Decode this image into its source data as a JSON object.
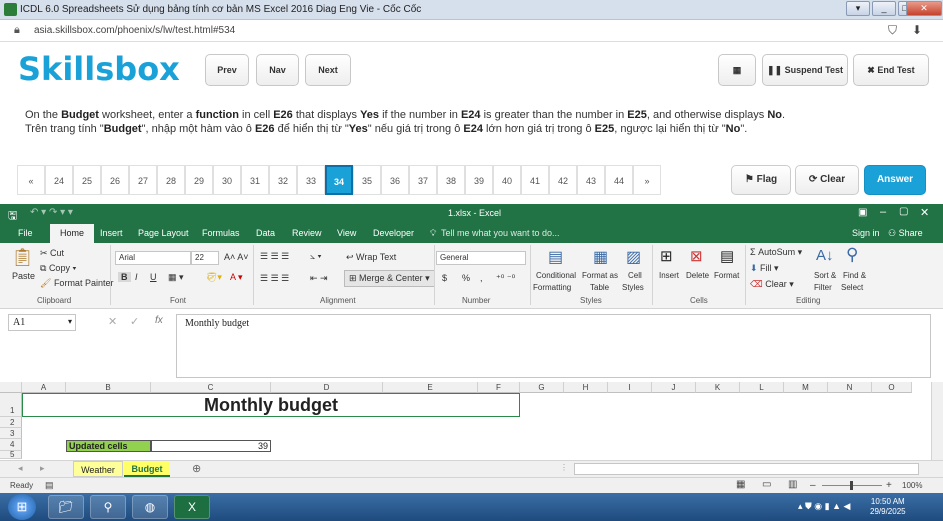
{
  "browser": {
    "title": "ICDL 6.0 Spreadsheets Sử dụng bảng tính cơ bản MS Excel 2016 Diag Eng Vie - Cốc Cốc",
    "url": "asia.skillsbox.com/phoenix/s/lw/test.html#534"
  },
  "skillsbox": {
    "logo": "Skillsbox",
    "prev": "Prev",
    "nav": "Nav",
    "next": "Next",
    "suspend": "Suspend Test",
    "end": "End Test"
  },
  "instruction": {
    "en": [
      "On the ",
      "Budget",
      " worksheet, enter a ",
      "function",
      " in cell ",
      "E26",
      " that displays ",
      "Yes",
      " if the number in ",
      "E24",
      " is greater than the number in ",
      "E25",
      ", and otherwise displays ",
      "No",
      "."
    ],
    "vi": [
      "Trên trang tính \"",
      "Budget",
      "\", nhập một hàm vào ô ",
      "E26",
      " để hiển thị từ \"",
      "Yes",
      "\" nếu giá trị trong ô ",
      "E24",
      " lớn hơn giá trị trong ô ",
      "E25",
      ", ngược lại hiển thị từ \"",
      "No",
      "\"."
    ]
  },
  "questions": {
    "first": "«",
    "last": "»",
    "numbers": [
      "24",
      "25",
      "26",
      "27",
      "28",
      "29",
      "30",
      "31",
      "32",
      "33",
      "34",
      "35",
      "36",
      "37",
      "38",
      "39",
      "40",
      "41",
      "42",
      "43",
      "44"
    ],
    "active": "34",
    "flag": "Flag",
    "clear": "Clear",
    "answer": "Answer"
  },
  "excel": {
    "filename": "1.xlsx - Excel",
    "tabs": [
      "File",
      "Home",
      "Insert",
      "Page Layout",
      "Formulas",
      "Data",
      "Review",
      "View",
      "Developer"
    ],
    "tellme": "Tell me what you want to do...",
    "signin": "Sign in",
    "share": "Share",
    "clipboard": {
      "paste": "Paste",
      "cut": "Cut",
      "copy": "Copy",
      "format_painter": "Format Painter",
      "label": "Clipboard"
    },
    "font": {
      "name": "Arial",
      "size": "22",
      "label": "Font",
      "b": "B",
      "i": "I",
      "u": "U"
    },
    "alignment": {
      "wrap": "Wrap Text",
      "merge": "Merge & Center",
      "label": "Alignment"
    },
    "number": {
      "format": "General",
      "label": "Number",
      "currency": "$",
      "percent": "%",
      "comma": ","
    },
    "styles": {
      "conditional": "Conditional",
      "formatting": "Formatting",
      "format_as": "Format as",
      "table": "Table",
      "cell": "Cell",
      "styles": "Styles",
      "label": "Styles"
    },
    "cells": {
      "insert": "Insert",
      "delete": "Delete",
      "format": "Format",
      "label": "Cells"
    },
    "editing": {
      "autosum": "AutoSum",
      "fill": "Fill",
      "clear": "Clear",
      "sort": "Sort &",
      "filter": "Filter",
      "find": "Find &",
      "select": "Select",
      "label": "Editing"
    },
    "namebox": "A1",
    "formula": "Monthly budget",
    "columns": [
      "A",
      "B",
      "C",
      "D",
      "E",
      "F",
      "G",
      "H",
      "I",
      "J",
      "K",
      "L",
      "M",
      "N",
      "O"
    ],
    "rows": [
      "1",
      "2",
      "3",
      "4",
      "5"
    ],
    "cells_data": {
      "title": "Monthly budget",
      "updated_label": "Updated cells",
      "updated_value": "39"
    },
    "sheets": [
      "Weather",
      "Budget"
    ],
    "status": "Ready",
    "zoom": "100%"
  },
  "taskbar": {
    "time": "10:50 AM",
    "date": "29/9/2025"
  }
}
